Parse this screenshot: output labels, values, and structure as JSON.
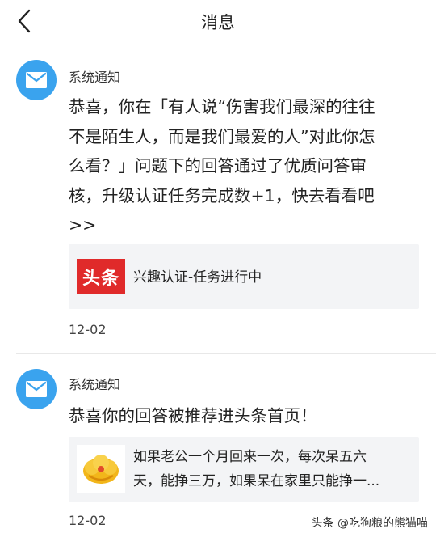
{
  "header": {
    "title": "消息"
  },
  "messages": [
    {
      "sender": "系统通知",
      "text_lines": [
        "恭喜，你在「有人说“伤害我们最深的往往",
        "不是陌生人，而是我们最爱的人”对此你怎",
        "么看？」问题下的回答通过了优质问答审",
        "核，升级认证任务完成数+1，快去看看吧",
        ">>"
      ],
      "card": {
        "logo_text": "头条",
        "title": "兴趣认证-任务进行中"
      },
      "date": "12-02"
    },
    {
      "sender": "系统通知",
      "text_lines": [
        "恭喜你的回答被推荐进头条首页！"
      ],
      "card": {
        "excerpt_lines": [
          "如果老公一个月回来一次，每次呆五六",
          "天，能挣三万，如果呆在家里只能挣一..."
        ]
      },
      "date": "12-02"
    }
  ],
  "watermark": "头条 @吃狗粮的熊猫喵",
  "colors": {
    "avatar": "#3aa3ee",
    "toutiao_red": "#e02a2a",
    "card_bg": "#f3f4f6"
  },
  "icons": {
    "back": "chevron-left-icon",
    "avatar": "mail-icon",
    "card2_thumb": "cloud-emblem-icon"
  }
}
